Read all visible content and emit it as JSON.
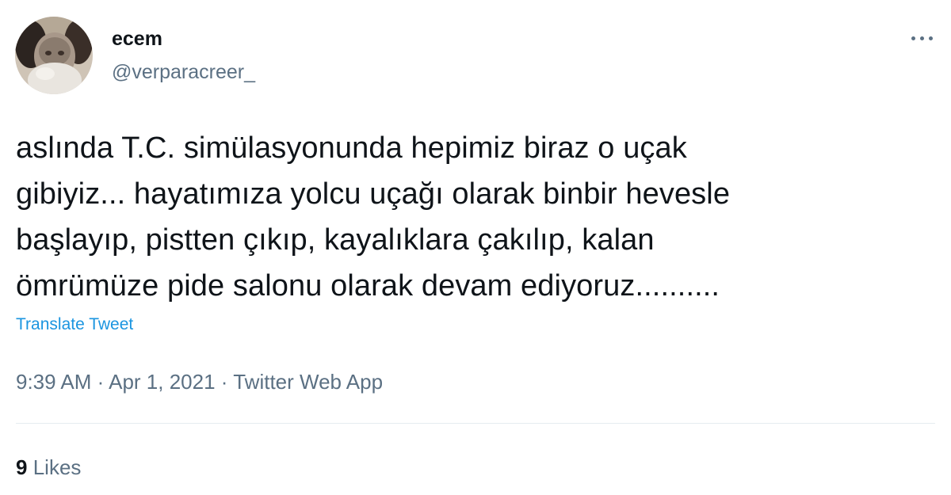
{
  "user": {
    "display_name": "ecem",
    "handle": "@verparacreer_"
  },
  "tweet": {
    "text": "aslında T.C. simülasyonunda hepimiz biraz o uçak\ngibiyiz... hayatımıza yolcu uçağı olarak binbir hevesle\nbaşlayıp, pistten çıkıp, kayalıklara çakılıp, kalan\nömrümüze pide salonu olarak devam ediyoruz..........",
    "translate_label": "Translate Tweet"
  },
  "meta": {
    "time": "9:39 AM",
    "separator": "·",
    "date": "Apr 1, 2021",
    "source": "Twitter Web App"
  },
  "stats": {
    "likes_count": "9",
    "likes_label": "Likes"
  },
  "icons": {
    "more": "more-horizontal-icon"
  },
  "colors": {
    "text": "#0f1419",
    "secondary": "#5b7083",
    "link": "#1b95e0",
    "divider": "#e6ecf0"
  }
}
